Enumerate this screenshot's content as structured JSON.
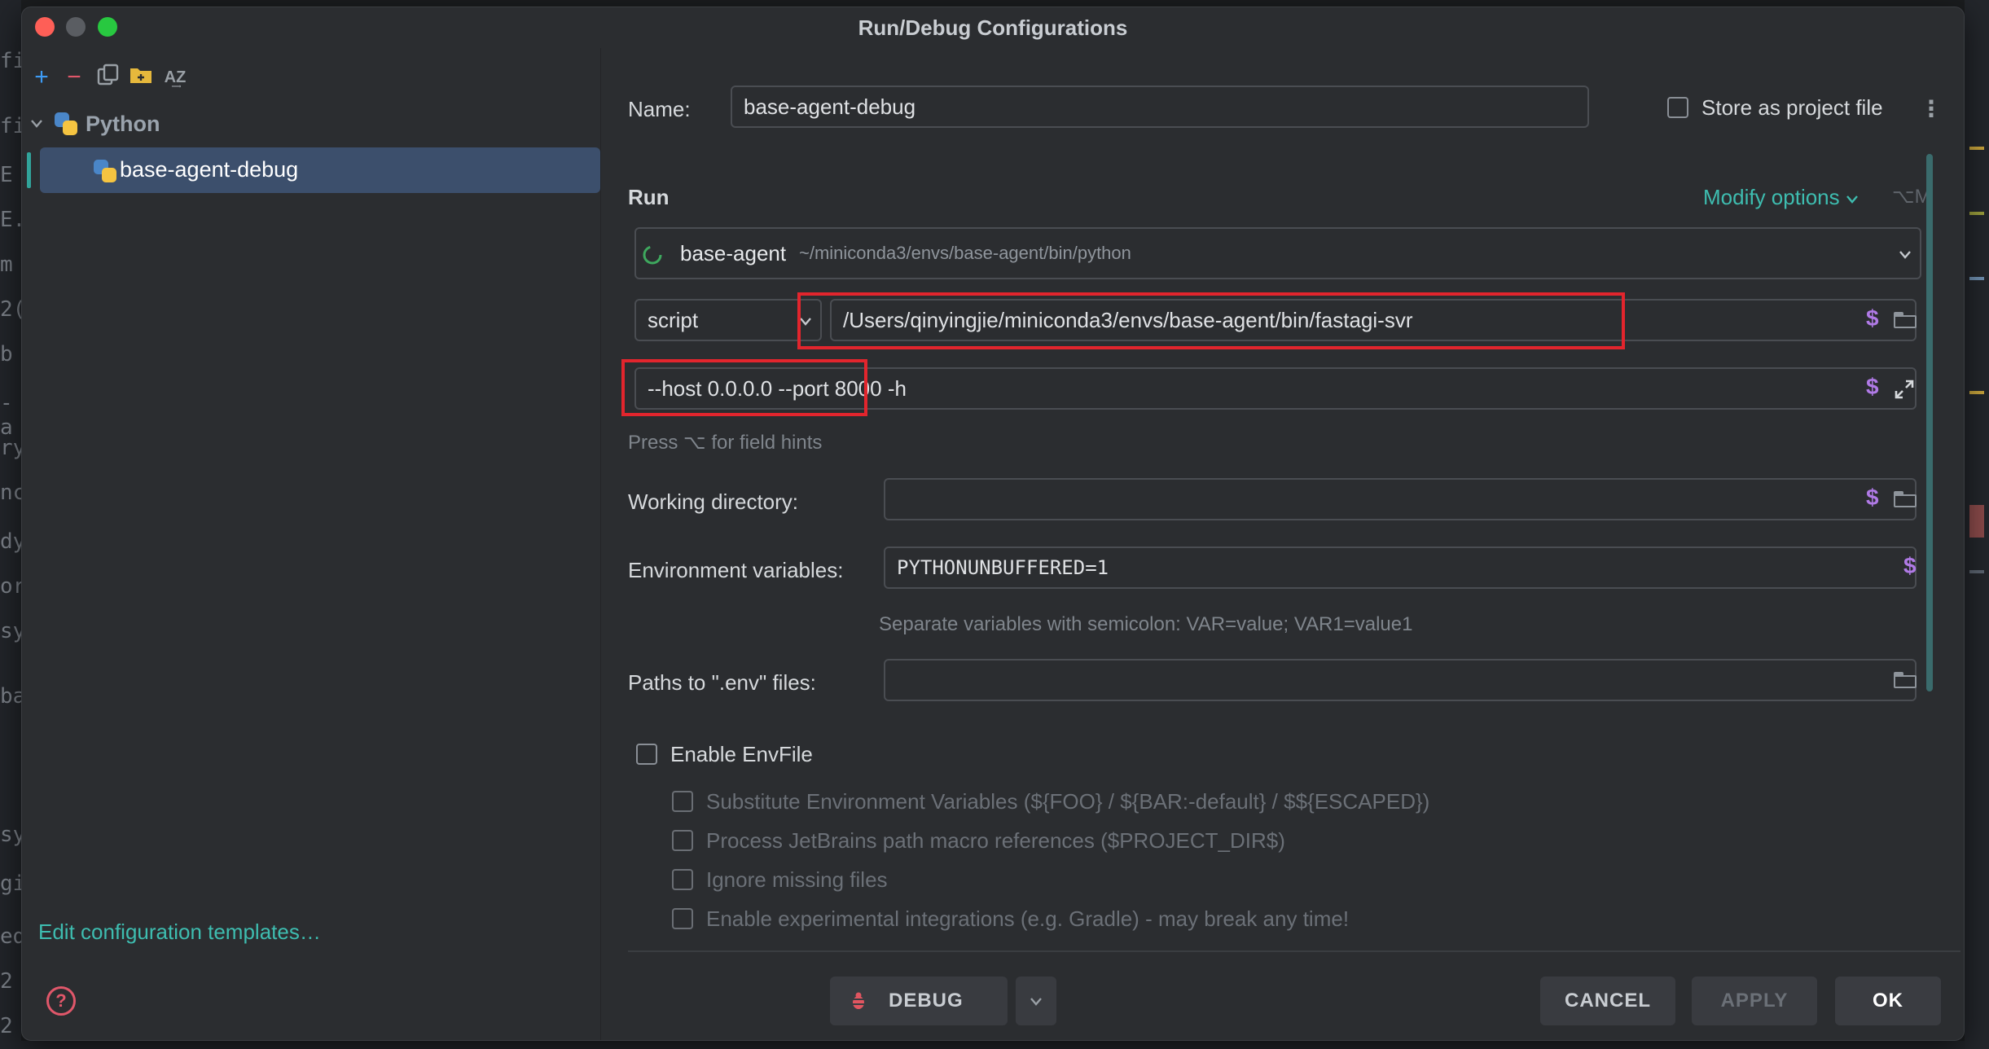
{
  "dialog": {
    "title": "Run/Debug Configurations"
  },
  "toolbar": {
    "add": "+",
    "remove": "−",
    "sort": "A͢Z"
  },
  "tree": {
    "group_label": "Python",
    "selected_item": "base-agent-debug"
  },
  "left_footer": {
    "edit_templates": "Edit configuration templates…",
    "help": "?"
  },
  "form": {
    "name_label": "Name:",
    "name_value": "base-agent-debug",
    "store_label": "Store as project file",
    "run_section": "Run",
    "modify_options": "Modify options",
    "modify_shortcut": "⌥M",
    "interpreter_name": "base-agent",
    "interpreter_path": "~/miniconda3/envs/base-agent/bin/python",
    "script_mode": "script",
    "script_path": "/Users/qinyingjie/miniconda3/envs/base-agent/bin/fastagi-svr",
    "params": "--host 0.0.0.0  --port 8000 -h",
    "field_hint": "Press ⌥ for field hints",
    "workdir_label": "Working directory:",
    "workdir_value": "",
    "env_label": "Environment variables:",
    "env_value": "PYTHONUNBUFFERED=1",
    "env_hint": "Separate variables with semicolon: VAR=value; VAR1=value1",
    "dotenv_label": "Paths to \".env\" files:",
    "dotenv_value": "",
    "dollar": "$"
  },
  "envfile": {
    "enable_label": "Enable EnvFile",
    "options": [
      "Substitute Environment Variables (${FOO} / ${BAR:-default} / $${ESCAPED})",
      "Process JetBrains path macro references ($PROJECT_DIR$)",
      "Ignore missing files",
      "Enable experimental integrations (e.g. Gradle) - may break any time!"
    ]
  },
  "buttons": {
    "debug": "DEBUG",
    "cancel": "CANCEL",
    "apply": "APPLY",
    "ok": "OK"
  },
  "colors": {
    "accent": "#3ebdb0",
    "selection": "#3c4f6c",
    "highlight": "#e2252d",
    "macro": "#b07ae6"
  }
}
